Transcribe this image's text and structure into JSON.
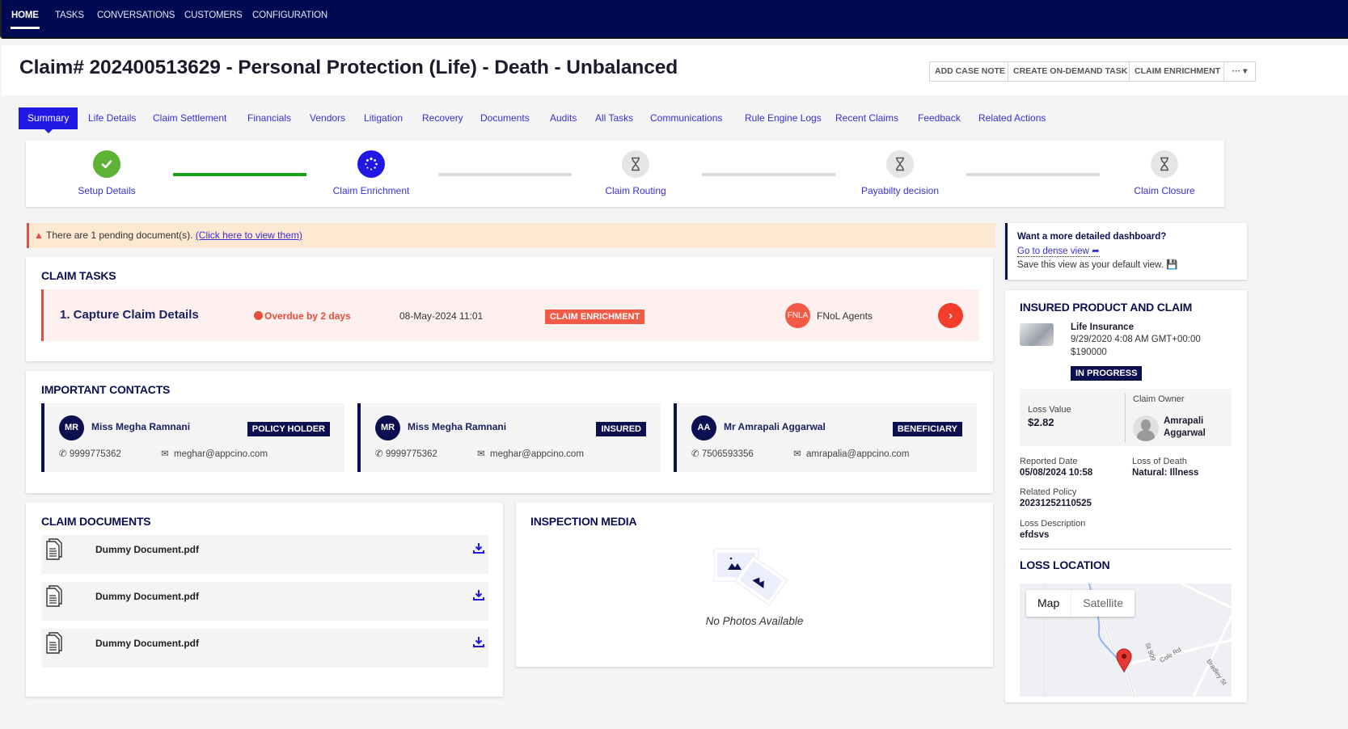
{
  "topnav": {
    "items": [
      {
        "label": "HOME",
        "active": true
      },
      {
        "label": "TASKS"
      },
      {
        "label": "CONVERSATIONS"
      },
      {
        "label": "CUSTOMERS"
      },
      {
        "label": "CONFIGURATION"
      }
    ]
  },
  "header": {
    "title": "Claim# 202400513629 - Personal Protection (Life) - Death - Unbalanced",
    "buttons": {
      "add_case_note": "ADD CASE NOTE",
      "create_task": "CREATE ON-DEMAND TASK",
      "claim_enrichment": "CLAIM ENRICHMENT",
      "more": "··· ▾"
    }
  },
  "tabs": [
    {
      "label": "Summary",
      "active": true
    },
    {
      "label": "Life Details"
    },
    {
      "label": "Claim Settlement"
    },
    {
      "label": "Financials"
    },
    {
      "label": "Vendors"
    },
    {
      "label": "Litigation"
    },
    {
      "label": "Recovery"
    },
    {
      "label": "Documents"
    },
    {
      "label": "Audits"
    },
    {
      "label": "All Tasks"
    },
    {
      "label": "Communications"
    },
    {
      "label": "Rule Engine Logs"
    },
    {
      "label": "Recent Claims"
    },
    {
      "label": "Feedback"
    },
    {
      "label": "Related Actions"
    }
  ],
  "stepper": {
    "steps": [
      {
        "label": "Setup Details",
        "status": "complete",
        "icon": "check-icon"
      },
      {
        "label": "Claim Enrichment",
        "status": "in-progress",
        "icon": "spinner-icon"
      },
      {
        "label": "Claim Routing",
        "status": "pending",
        "icon": "hourglass-icon"
      },
      {
        "label": "Payabilty decision",
        "status": "pending",
        "icon": "hourglass-icon"
      },
      {
        "label": "Claim Closure",
        "status": "pending",
        "icon": "hourglass-icon"
      }
    ],
    "colors": {
      "complete": "#5cb335",
      "active": "#2118e6",
      "pending": "#e5e5e5",
      "line_done": "#19a119"
    }
  },
  "alert": {
    "text": "There are 1 pending document(s).",
    "link": "(Click here to view them)"
  },
  "claim_tasks": {
    "title": "CLAIM TASKS",
    "task": {
      "name": "1. Capture Claim Details",
      "overdue": "Overdue by 2 days",
      "date": "08-May-2024 11:01",
      "stage": "CLAIM ENRICHMENT",
      "assignee_initials": "FNLA",
      "assignee": "FNoL Agents"
    }
  },
  "contacts": {
    "title": "IMPORTANT CONTACTS",
    "items": [
      {
        "initials": "MR",
        "name": "Miss Megha Ramnani",
        "role": "POLICY HOLDER",
        "phone": "9999775362",
        "email": "meghar@appcino.com"
      },
      {
        "initials": "MR",
        "name": "Miss Megha Ramnani",
        "role": "INSURED",
        "phone": "9999775362",
        "email": "meghar@appcino.com"
      },
      {
        "initials": "AA",
        "name": "Mr Amrapali Aggarwal",
        "role": "BENEFICIARY",
        "phone": "7506593356",
        "email": "amrapalia@appcino.com"
      }
    ]
  },
  "documents": {
    "title": "CLAIM DOCUMENTS",
    "items": [
      {
        "name": "Dummy Document.pdf"
      },
      {
        "name": "Dummy Document.pdf"
      },
      {
        "name": "Dummy Document.pdf"
      }
    ]
  },
  "media": {
    "title": "INSPECTION MEDIA",
    "empty": "No Photos Available"
  },
  "dense": {
    "question": "Want a more detailed dashboard?",
    "link": "Go to dense view",
    "save": "Save this view as your default view."
  },
  "product": {
    "title": "INSURED PRODUCT AND CLAIM",
    "name": "Life Insurance",
    "date": "9/29/2020 4:08 AM GMT+00:00",
    "amount": "$190000",
    "status": "IN PROGRESS",
    "loss_value_label": "Loss Value",
    "loss_value": "$2.82",
    "owner_label": "Claim Owner",
    "owner": "Amrapali Aggarwal",
    "reported_label": "Reported Date",
    "reported": "05/08/2024 10:58",
    "death_label": "Loss of Death",
    "death": "Natural: Illness",
    "policy_label": "Related Policy",
    "policy": "20231252110525",
    "desc_label": "Loss Description",
    "desc": "efdsvs"
  },
  "location": {
    "title": "LOSS LOCATION",
    "map_btn": "Map",
    "sat_btn": "Satellite",
    "road1": "St 909",
    "road2": "Cole Rd",
    "road3": "Bradley St"
  }
}
